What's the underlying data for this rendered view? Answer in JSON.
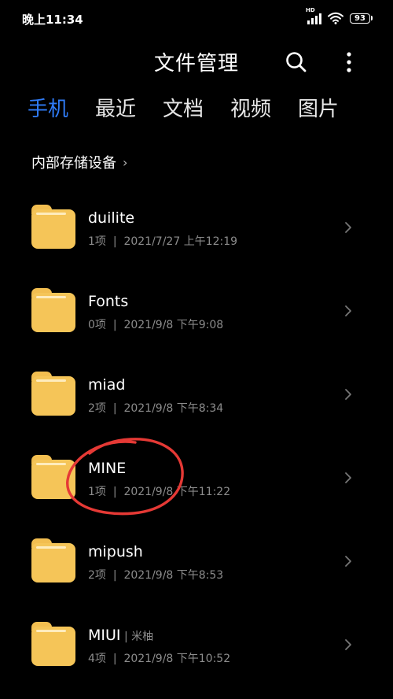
{
  "status_bar": {
    "time": "晚上11:34",
    "signal_badge": "HD",
    "battery": "93"
  },
  "header": {
    "title": "文件管理",
    "search_icon": "search-icon",
    "more_icon": "more-vertical-icon"
  },
  "tabs": [
    {
      "label": "手机",
      "active": true
    },
    {
      "label": "最近",
      "active": false
    },
    {
      "label": "文档",
      "active": false
    },
    {
      "label": "视频",
      "active": false
    },
    {
      "label": "图片",
      "active": false
    }
  ],
  "breadcrumb": {
    "label": "内部存储设备",
    "chevron": "›"
  },
  "folders": [
    {
      "name": "duilite",
      "count": "1项",
      "sep": "|",
      "date": "2021/7/27 上午12:19"
    },
    {
      "name": "Fonts",
      "count": "0项",
      "sep": "|",
      "date": "2021/9/8 下午9:08"
    },
    {
      "name": "miad",
      "count": "2项",
      "sep": "|",
      "date": "2021/9/8 下午8:34"
    },
    {
      "name": "MINE",
      "count": "1项",
      "sep": "|",
      "date": "2021/9/8 下午11:22"
    },
    {
      "name": "mipush",
      "count": "2项",
      "sep": "|",
      "date": "2021/9/8 下午8:53"
    },
    {
      "name": "MIUI",
      "tag_sep": "|",
      "tag": "米柚",
      "count": "4项",
      "sep": "|",
      "date": "2021/9/8 下午10:52"
    }
  ],
  "colors": {
    "accent": "#2f7bf6",
    "folder": "#f5c558",
    "annotation": "#e53935",
    "background": "#000000"
  }
}
